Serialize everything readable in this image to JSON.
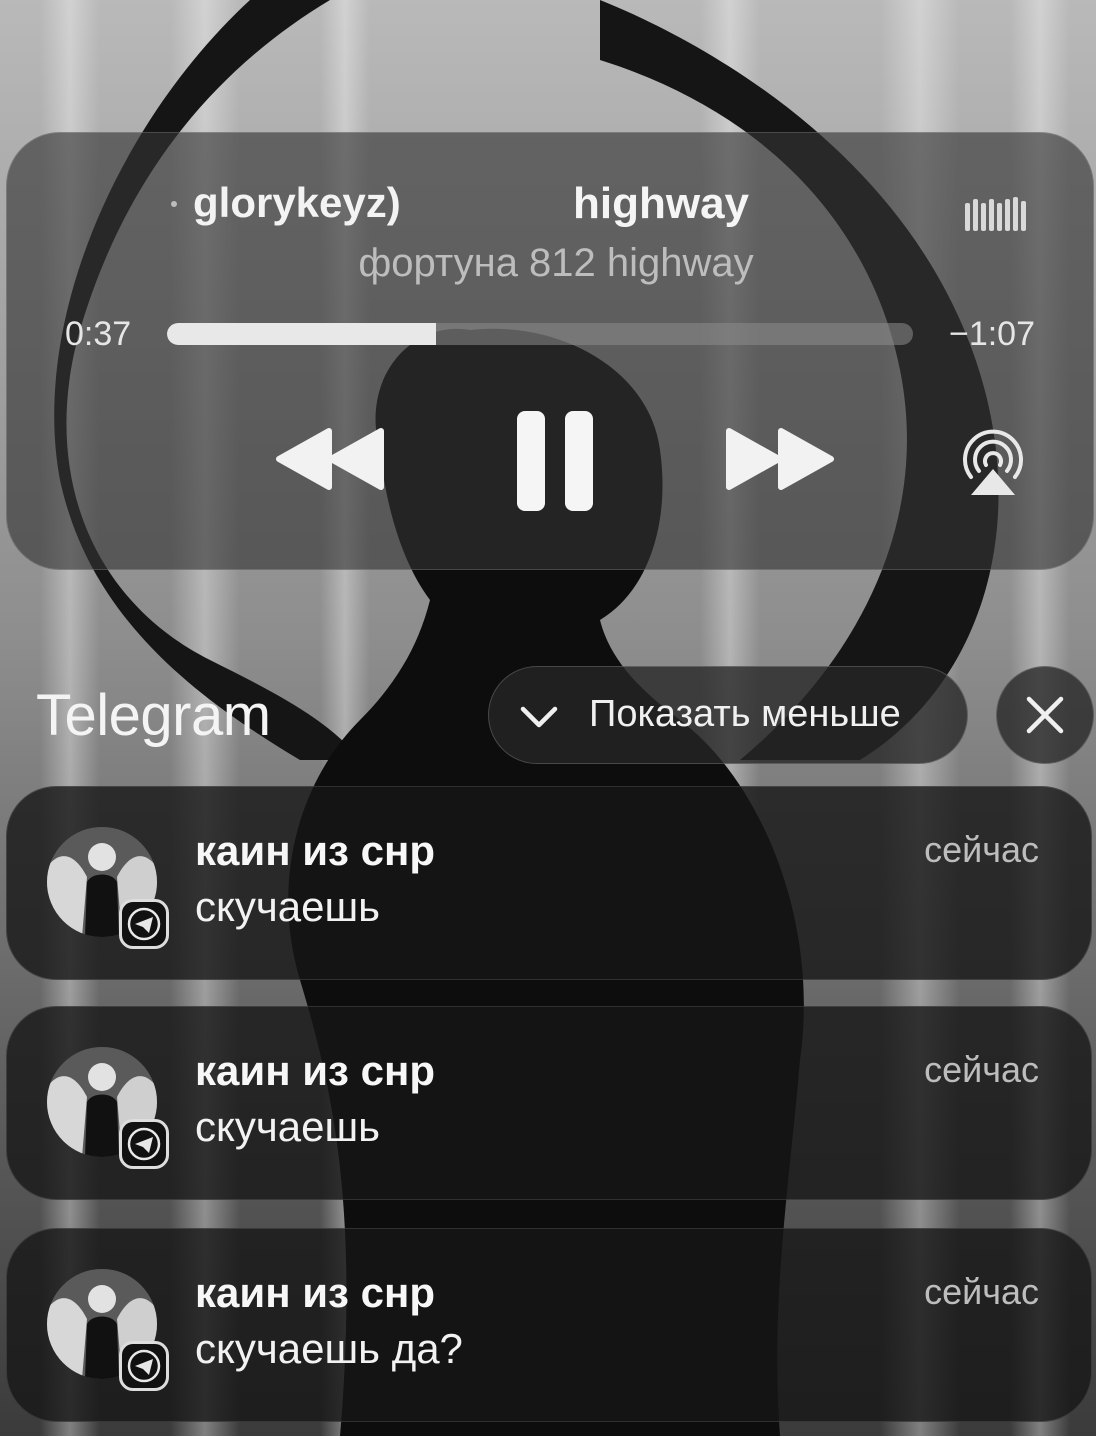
{
  "player": {
    "marquee_prev": "glorykeyz)",
    "track_title": "highway",
    "artist": "фортуна 812 highway",
    "elapsed": "0:37",
    "remaining": "−1:07",
    "progress_fraction": 0.36,
    "icons": {
      "rewind": "rewind-icon",
      "pause": "pause-icon",
      "forward": "fast-forward-icon",
      "airplay": "airplay-icon",
      "waveform": "waveform-icon"
    }
  },
  "notification_group": {
    "app_name": "Telegram",
    "show_less_label": "Показать меньше"
  },
  "notifications": [
    {
      "sender": "каин из снр",
      "message": "скучаешь",
      "time": "сейчас"
    },
    {
      "sender": "каин из снр",
      "message": "скучаешь",
      "time": "сейчас"
    },
    {
      "sender": "каин из снр",
      "message": "скучаешь да?",
      "time": "сейчас"
    }
  ]
}
